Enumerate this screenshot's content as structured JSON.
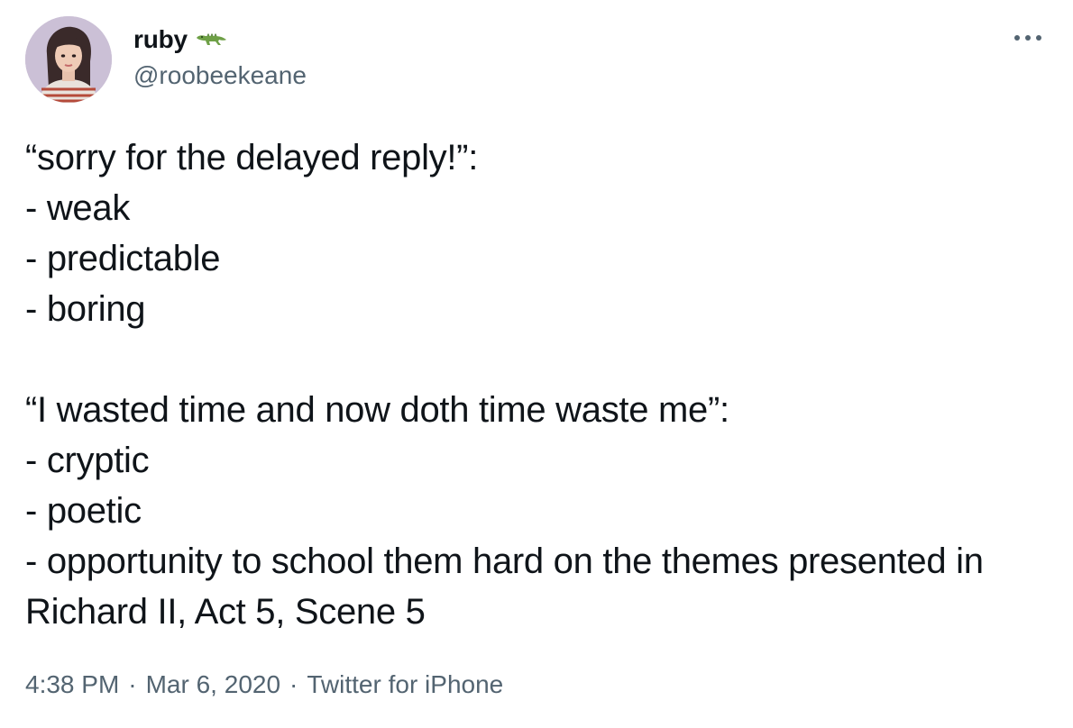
{
  "author": {
    "display_name": "ruby",
    "badge_emoji": "crocodile-icon",
    "handle": "@roobeekeane",
    "avatar": "avatar-photo"
  },
  "more_menu": {
    "icon": "more-horizontal-icon"
  },
  "tweet": {
    "text": "“sorry for the delayed reply!”:\n- weak\n- predictable\n- boring\n\n“I wasted time and now doth time waste me”:\n- cryptic\n- poetic\n- opportunity to school them hard on the themes presented in Richard II, Act 5, Scene 5"
  },
  "meta": {
    "time": "4:38 PM",
    "separator": "·",
    "date": "Mar 6, 2020",
    "source": "Twitter for iPhone"
  },
  "colors": {
    "text_primary": "#0f1419",
    "text_secondary": "#536471",
    "badge_green": "#6ea046"
  }
}
